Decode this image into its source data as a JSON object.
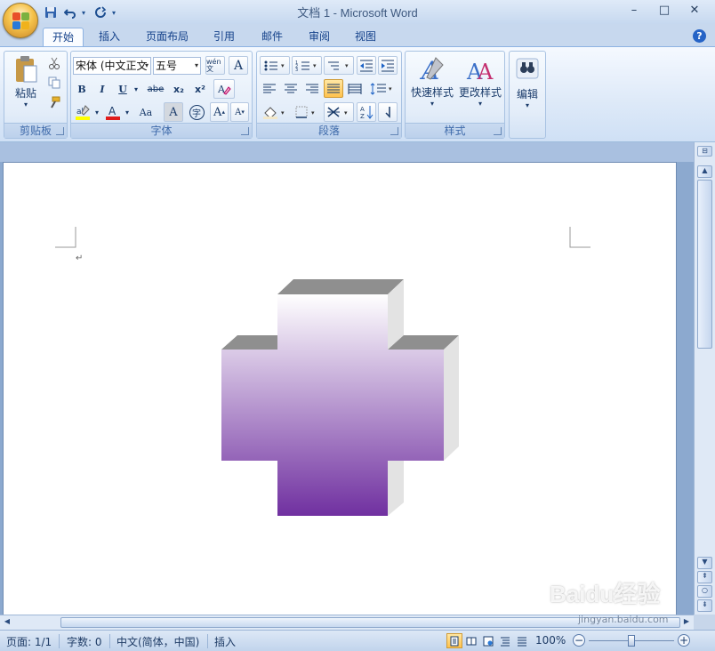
{
  "window": {
    "title": "文档 1 - Microsoft Word",
    "controls": {
      "minimize": "–",
      "maximize": "□",
      "close": "✕"
    }
  },
  "qat": {
    "icons": [
      "save-icon",
      "undo-icon",
      "redo-icon",
      "customize-icon"
    ]
  },
  "tabs": [
    {
      "label": "开始",
      "active": true
    },
    {
      "label": "插入"
    },
    {
      "label": "页面布局"
    },
    {
      "label": "引用"
    },
    {
      "label": "邮件"
    },
    {
      "label": "审阅"
    },
    {
      "label": "视图"
    }
  ],
  "ribbon": {
    "clipboard": {
      "label": "剪贴板",
      "paste_label": "粘贴"
    },
    "font": {
      "label": "字体",
      "font_name": "宋体 (中文正文",
      "font_size": "五号",
      "bold": "B",
      "italic": "I",
      "underline": "U",
      "strike": "abe",
      "subscript": "x₂",
      "superscript": "x²",
      "grow": "A",
      "shrink": "A",
      "case": "Aa",
      "char_border": "A",
      "enclose": "字",
      "phonetic": "wén 文"
    },
    "paragraph": {
      "label": "段落"
    },
    "styles": {
      "label": "样式",
      "quick_styles": "快速样式",
      "change_styles": "更改样式"
    },
    "editing": {
      "label": "编辑"
    }
  },
  "document": {
    "shape": "3d-cross",
    "gradient_colors": {
      "top": "#ffffff",
      "bottom": "#7030a0"
    },
    "side_color": "#e3e3e3",
    "top_face_color": "#8f8f8f"
  },
  "statusbar": {
    "page": "页面: 1/1",
    "words": "字数: 0",
    "language": "中文(简体，中国)",
    "mode": "插入",
    "zoom": "100%",
    "zoom_level": 1.0
  },
  "watermark": {
    "text": "Baidu经验",
    "url": "jingyan.baidu.com"
  }
}
